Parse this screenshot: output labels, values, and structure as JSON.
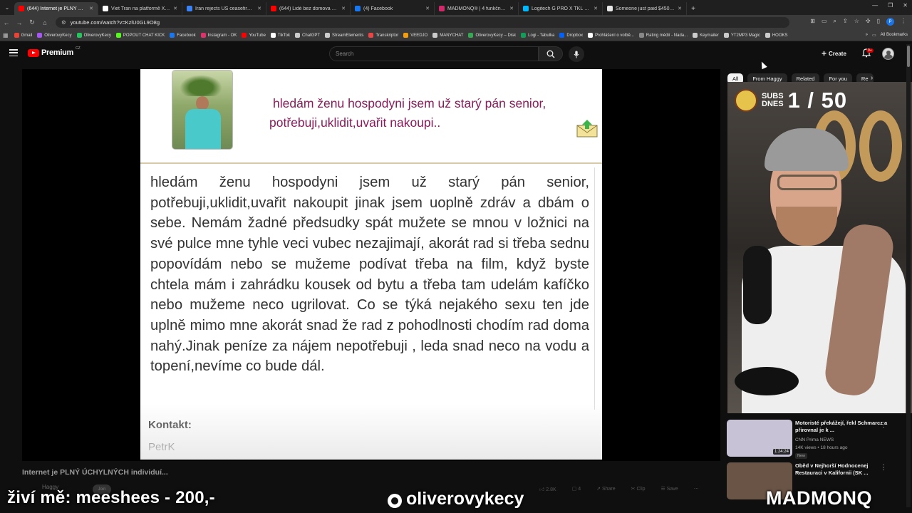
{
  "browser": {
    "tabs": [
      {
        "title": "(644) Internet je PLNÝ ÚCHYLNÝCH",
        "color": "#ff0000",
        "active": true
      },
      {
        "title": "Viet Tran na platformě X: „@...",
        "color": "#ffffff",
        "active": false
      },
      {
        "title": "Iran rejects US ceasefire plan a...",
        "color": "#3b82f6",
        "active": false
      },
      {
        "title": "(644) Lidé bez domova v rámci...",
        "color": "#ff0000",
        "active": false
      },
      {
        "title": "(4) Facebook",
        "color": "#1877f2",
        "active": false
      },
      {
        "title": "MADMONQ® | 4 funkční dopl...",
        "color": "#d12a6a",
        "active": false
      },
      {
        "title": "Logitech G PRO X TKL LIGHTSP...",
        "color": "#00b8fc",
        "active": false
      },
      {
        "title": "Someone just paid $450,000 to...",
        "color": "#e6e6e6",
        "active": false
      }
    ],
    "url": "youtube.com/watch?v=KzlU0GL9O8g",
    "bookmarks": [
      {
        "label": "Gmail",
        "color": "#ea4335"
      },
      {
        "label": "OliverovyKecy",
        "color": "#a855f7"
      },
      {
        "label": "OliverovyKecy",
        "color": "#22c55e"
      },
      {
        "label": "POPOUT CHAT KICK",
        "color": "#53fc18"
      },
      {
        "label": "Facebook",
        "color": "#1877f2"
      },
      {
        "label": "Instagram - OK",
        "color": "#e1306c"
      },
      {
        "label": "YouTube",
        "color": "#ff0000"
      },
      {
        "label": "TikTok",
        "color": "#ffffff"
      },
      {
        "label": "ChatGPT",
        "color": "#cccccc"
      },
      {
        "label": "StreamElements",
        "color": "#cccccc"
      },
      {
        "label": "Transkriptor",
        "color": "#ef4444"
      },
      {
        "label": "VEEDJO",
        "color": "#f59e0b"
      },
      {
        "label": "MANYCHAT",
        "color": "#cccccc"
      },
      {
        "label": "OliverovyKecy – Disk",
        "color": "#34a853"
      },
      {
        "label": "Logi - Tabulka",
        "color": "#0f9d58"
      },
      {
        "label": "Dropbox",
        "color": "#0061ff"
      },
      {
        "label": "Prohlášení o volbě...",
        "color": "#ffffff"
      },
      {
        "label": "Rating médií - Nada...",
        "color": "#888888"
      },
      {
        "label": "Keymailer",
        "color": "#cccccc"
      },
      {
        "label": "YT2MP3 Magic",
        "color": "#cccccc"
      },
      {
        "label": "HOOKS",
        "color": "#cccccc"
      }
    ],
    "all_bookmarks": "All Bookmarks"
  },
  "youtube": {
    "logo_text": "Premium",
    "region": "CZ",
    "search_placeholder": "Search",
    "create_label": "Create",
    "notifications_badge": "9+",
    "chips": [
      "All",
      "From Haggy",
      "Related",
      "For you",
      "Re"
    ]
  },
  "slide": {
    "headline_line1": "hledám ženu hospodyni jsem už starý pán senior,",
    "headline_line2": "potřebuji,uklidit,uvařit nakoupi..",
    "body": "hledám ženu hospodyni jsem už starý pán senior, potřebuji,uklidit,uvařit nakoupit jinak jsem uoplně zdráv a dbám o sebe. Nemám žadné předsudky spát mužete se mnou v ložnici na své pulce mne tyhle veci vubec nezajimají, akorát rad si třeba sednu popovídám nebo se mužeme podívat třeba na film, když byste chtela mám i zahrádku kousek od bytu a třeba tam udelám kafíčko nebo mužeme neco ugrilovat. Co se týká nejakého sexu ten jde uplně mimo mne akorát snad že rad z pohodlnosti chodím rad doma nahý.Jinak peníze za nájem nepotřebuji , leda snad neco na vodu a topení,nevíme co bude dál.",
    "contact_label": "Kontakt:",
    "signer": "PetrK"
  },
  "video": {
    "title": "Internet je PLNÝ ÚCHYLNÝCH individuí...",
    "channel": "Haggy",
    "join_label": "Join",
    "likes": "2.8K",
    "comments": "4",
    "share_label": "Share",
    "clip_label": "Clip",
    "save_label": "Save"
  },
  "webcam": {
    "subs_label_1": "SUBS",
    "subs_label_2": "DNES",
    "subs_count": "1 / 50"
  },
  "recommended": [
    {
      "title": "Motoristé překážejí, řekl Schmarcz a přirovnal je k ...",
      "channel": "CNN Prima NEWS",
      "meta": "14K views • 18 hours ago",
      "badge": "New",
      "duration": "1:24:24",
      "thumb_color": "#c7c2d6"
    },
    {
      "title": "Oběd v Nejhorší Hodnocenej Restauraci v Kalifornii (SK ...",
      "channel": "",
      "meta": "",
      "badge": "",
      "duration": "",
      "thumb_color": "#6a5446"
    }
  ],
  "overlay": {
    "left": "živí mě: meeshees - 200,-",
    "middle": "oliverovykecy",
    "right": "MADMONQ"
  }
}
